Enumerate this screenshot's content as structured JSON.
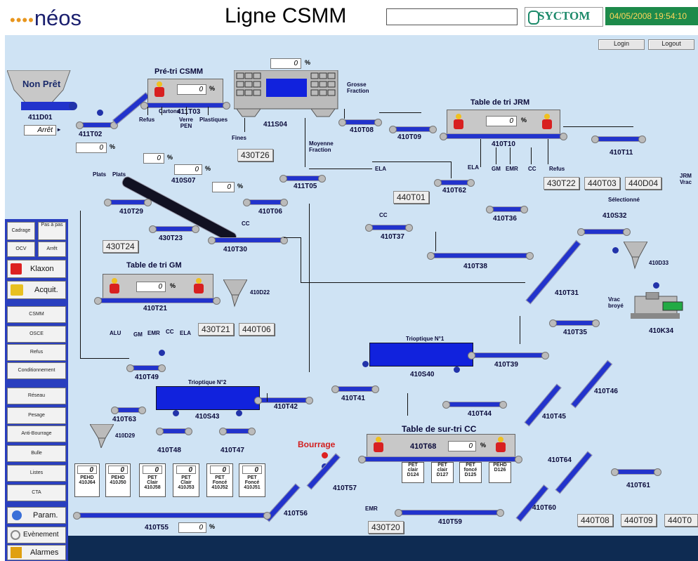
{
  "header": {
    "logo_text": "néos",
    "logo_dots": "••••",
    "title": "Ligne CSMM",
    "brand": "SYCTOM",
    "datetime": "04/05/2008 19:54:10",
    "login_label": "Login",
    "logout_label": "Logout"
  },
  "feed": {
    "status_label": "Non Prêt",
    "hopper_id": "411D01",
    "state_value": "Arrêt",
    "conveyor": "411T02",
    "conveyor_pct": "0"
  },
  "pretri": {
    "title": "Pré-tri CSMM",
    "pct": "0",
    "conveyor": "411T03",
    "outputs": [
      "Refus",
      "Cartons",
      "Verre PEN",
      "Plastiques"
    ]
  },
  "trommel": {
    "id": "411S04",
    "pct": "0",
    "grosse": "Grosse Fraction",
    "moyenne": "Moyenne Fraction",
    "fines": "Fines",
    "fines_tag": "430T26"
  },
  "conveyors": {
    "t08": "410T08",
    "t09": "410T09",
    "t05": "411T05",
    "t06": "410T06",
    "t29": "410T29",
    "t07": "410S07",
    "t23": "430T23",
    "t30": "410T30",
    "t62": "410T62",
    "t36": "410T36",
    "t37": "410T37",
    "t38": "410T38",
    "t11": "410T11",
    "s32": "410S32",
    "t31": "410T31",
    "t35": "410T35",
    "k34": "410K34",
    "t39": "410T39",
    "s40": "410S40",
    "t46": "410T46",
    "t41": "410T41",
    "t42": "410T42",
    "t44": "410T44",
    "t45": "410T45",
    "s43": "410S43",
    "t63": "410T63",
    "t48": "410T48",
    "t47": "410T47",
    "t49": "410T49",
    "t21": "410T21",
    "t55": "410T55",
    "t56": "410T56",
    "t57": "410T57",
    "t59": "410T59",
    "t60": "410T60",
    "t64": "410T64",
    "t61": "410T61",
    "t10": "410T10",
    "d22": "410D22",
    "d33": "410D33",
    "d29": "410D29"
  },
  "pcts": {
    "p29": "0",
    "p07a": "0",
    "p07b": "0",
    "p55": "0"
  },
  "tags": {
    "t24": "430T24",
    "t01": "440T01",
    "t22": "430T22",
    "t03": "440T03",
    "d04": "440D04",
    "t21b": "430T21",
    "t06b": "440T06",
    "t20": "430T20",
    "t08b": "440T08",
    "t09b": "440T09",
    "t0x": "440T0"
  },
  "jrm": {
    "title": "Table de tri JRM",
    "conveyor": "410T10",
    "pct": "0",
    "outputs": [
      "GM",
      "EMR",
      "CC",
      "Refus"
    ],
    "ela": "ELA",
    "selected": "Sélectionné",
    "side_label": "JRM Vrac"
  },
  "gm": {
    "title": "Table de tri GM",
    "conveyor": "410T21",
    "pct": "0",
    "outputs": [
      "ALU",
      "GM",
      "EMR",
      "CC",
      "ELA"
    ]
  },
  "labels": {
    "plats": "Plats",
    "plats2": "Plats",
    "cc": "CC",
    "cc2": "CC",
    "ela2": "ELA",
    "vrac": "Vrac broyé",
    "trio1": "Trioptique N°1",
    "trio2": "Trioptique N°2",
    "emr": "EMR",
    "bourrage": "Bourrage"
  },
  "surtri": {
    "title": "Table de sur-tri CC",
    "conveyor": "410T68",
    "pct": "0",
    "bins": [
      {
        "l1": "PET",
        "l2": "clair",
        "l3": "D124"
      },
      {
        "l1": "PET",
        "l2": "clair",
        "l3": "D127"
      },
      {
        "l1": "PET",
        "l2": "foncé",
        "l3": "D125"
      },
      {
        "l1": "PEHD",
        "l2": "D126",
        "l3": ""
      }
    ]
  },
  "silos": [
    {
      "pct": "0",
      "l1": "PEHD",
      "l2": "410J64"
    },
    {
      "pct": "0",
      "l1": "PEHD",
      "l2": "410J50"
    },
    {
      "pct": "0",
      "l1": "PET",
      "l2": "Clair",
      "l3": "410J58"
    },
    {
      "pct": "0",
      "l1": "PET",
      "l2": "Clair",
      "l3": "410J53"
    },
    {
      "pct": "0",
      "l1": "PET",
      "l2": "Foncé",
      "l3": "410J52"
    },
    {
      "pct": "0",
      "l1": "PET",
      "l2": "Foncé",
      "l3": "410J51"
    }
  ],
  "pct_sign": "%",
  "sidebar": {
    "calibrage": "Cadrage",
    "pas_a_pas": "Pas à pas",
    "ocv": "OCV",
    "arret": "Arrêt",
    "klaxon": "Klaxon",
    "acquit": "Acquit.",
    "nav": [
      "CSMM",
      "OSCE",
      "Refus",
      "Conditionnement",
      "Réseau",
      "Pesage",
      "Anti-Bourrage",
      "Bulle",
      "Listes",
      "CTA"
    ],
    "param": "Param.",
    "evenement": "Evènement",
    "alarmes": "Alarmes"
  }
}
